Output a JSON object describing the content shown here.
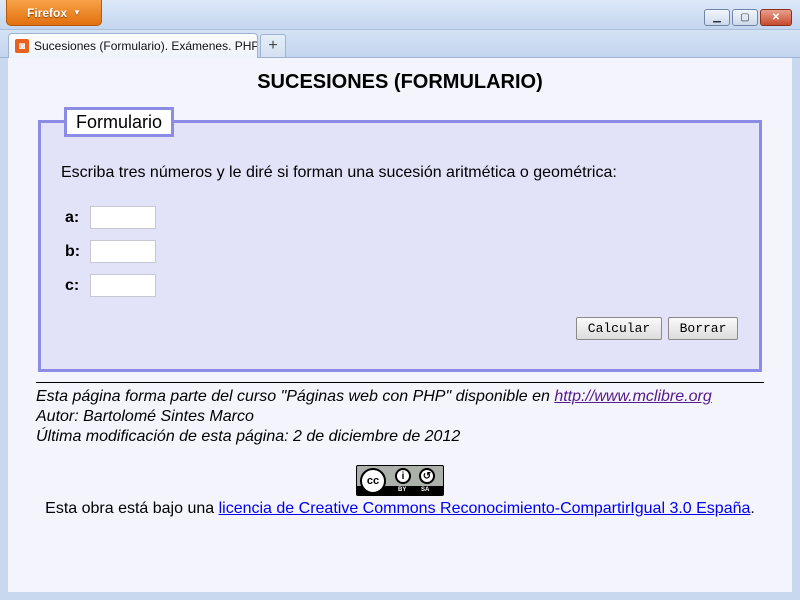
{
  "browser": {
    "menu_button": "Firefox",
    "window_controls": {
      "minimize": "▁",
      "maximize": "▢",
      "close": "✕"
    },
    "tab": {
      "title": "Sucesiones (Formulario). Exámenes. PHP..."
    },
    "new_tab": "+"
  },
  "page": {
    "title": "SUCESIONES (FORMULARIO)",
    "form": {
      "legend": "Formulario",
      "instructions": "Escriba tres números y le diré si forman una sucesión aritmética o geométrica:",
      "fields": [
        {
          "label": "a:",
          "value": ""
        },
        {
          "label": "b:",
          "value": ""
        },
        {
          "label": "c:",
          "value": ""
        }
      ],
      "submit_label": "Calcular",
      "reset_label": "Borrar"
    },
    "footer": {
      "course_text": "Esta página forma parte del curso \"Páginas web con PHP\" disponible en ",
      "course_link": "http://www.mclibre.org",
      "author": "Autor: Bartolomé Sintes Marco",
      "modified": "Última modificación de esta página: 2 de diciembre de 2012"
    },
    "license": {
      "badge": {
        "cc": "cc",
        "by": "BY",
        "sa": "SA"
      },
      "prefix": "Esta obra está bajo una ",
      "link_text": "licencia de Creative Commons Reconocimiento-CompartirIgual 3.0 España",
      "suffix": "."
    }
  }
}
